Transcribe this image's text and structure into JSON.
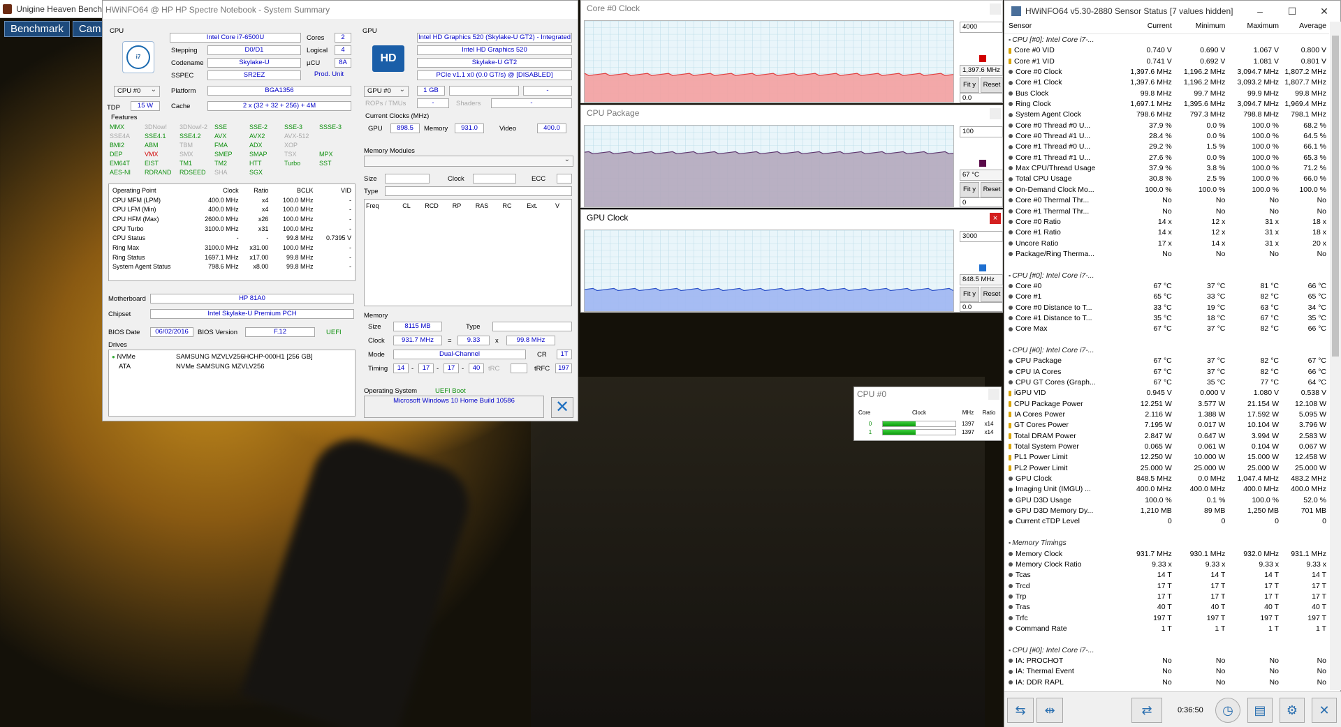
{
  "background": {
    "title": "Unigine Heaven Bench",
    "tabs": [
      "Benchmark",
      "Cam"
    ]
  },
  "summary": {
    "title": "HWiNFO64 @ HP HP Spectre Notebook - System Summary",
    "cpu": {
      "section": "CPU",
      "name": "Intel Core i7-6500U",
      "cores_label": "Cores",
      "cores": "2",
      "stepping_label": "Stepping",
      "stepping": "D0/D1",
      "logical_label": "Logical",
      "logical": "4",
      "codename_label": "Codename",
      "codename": "Skylake-U",
      "ucu_label": "µCU",
      "ucu": "8A",
      "sspec_label": "SSPEC",
      "sspec": "SR2EZ",
      "produnit": "Prod. Unit",
      "selector": "CPU #0",
      "platform_label": "Platform",
      "platform": "BGA1356",
      "tdp_label": "TDP",
      "tdp": "15 W",
      "cache_label": "Cache",
      "cache": "2 x (32 + 32 + 256) + 4M",
      "features_label": "Features"
    },
    "features": [
      [
        "MMX",
        "on"
      ],
      [
        "3DNow!",
        "off"
      ],
      [
        "3DNow!-2",
        "off"
      ],
      [
        "SSE",
        "on"
      ],
      [
        "SSE-2",
        "on"
      ],
      [
        "SSE-3",
        "on"
      ],
      [
        "SSSE-3",
        "on"
      ],
      [
        "SSE4A",
        "off"
      ],
      [
        "SSE4.1",
        "on"
      ],
      [
        "SSE4.2",
        "on"
      ],
      [
        "AVX",
        "on"
      ],
      [
        "AVX2",
        "on"
      ],
      [
        "AVX-512",
        "off"
      ],
      [
        "",
        ""
      ],
      [
        "BMI2",
        "on"
      ],
      [
        "ABM",
        "on"
      ],
      [
        "TBM",
        "off"
      ],
      [
        "FMA",
        "on"
      ],
      [
        "ADX",
        "on"
      ],
      [
        "XOP",
        "off"
      ],
      [
        "",
        ""
      ],
      [
        "DEP",
        "on"
      ],
      [
        "VMX",
        "red"
      ],
      [
        "SMX",
        "off"
      ],
      [
        "SMEP",
        "on"
      ],
      [
        "SMAP",
        "on"
      ],
      [
        "TSX",
        "off"
      ],
      [
        "MPX",
        "on"
      ],
      [
        "EM64T",
        "on"
      ],
      [
        "EIST",
        "on"
      ],
      [
        "TM1",
        "on"
      ],
      [
        "TM2",
        "on"
      ],
      [
        "HTT",
        "on"
      ],
      [
        "Turbo",
        "on"
      ],
      [
        "SST",
        "on"
      ],
      [
        "AES-NI",
        "on"
      ],
      [
        "RDRAND",
        "on"
      ],
      [
        "RDSEED",
        "on"
      ],
      [
        "SHA",
        "off"
      ],
      [
        "SGX",
        "on"
      ],
      [
        "",
        ""
      ],
      [
        "",
        ""
      ]
    ],
    "op_header": [
      "Operating Point",
      "Clock",
      "Ratio",
      "BCLK",
      "VID"
    ],
    "op_rows": [
      [
        "CPU MFM (LPM)",
        "400.0 MHz",
        "x4",
        "100.0 MHz",
        "-"
      ],
      [
        "CPU LFM (Min)",
        "400.0 MHz",
        "x4",
        "100.0 MHz",
        "-"
      ],
      [
        "CPU HFM (Max)",
        "2600.0 MHz",
        "x26",
        "100.0 MHz",
        "-"
      ],
      [
        "CPU Turbo",
        "3100.0 MHz",
        "x31",
        "100.0 MHz",
        "-"
      ],
      [
        "CPU Status",
        "-",
        "-",
        "99.8 MHz",
        "0.7395 V"
      ],
      [
        "Ring Max",
        "3100.0 MHz",
        "x31.00",
        "100.0 MHz",
        "-"
      ],
      [
        "Ring Status",
        "1697.1 MHz",
        "x17.00",
        "99.8 MHz",
        "-"
      ],
      [
        "System Agent Status",
        "798.6 MHz",
        "x8.00",
        "99.8 MHz",
        "-"
      ]
    ],
    "mb": {
      "mb_label": "Motherboard",
      "mb": "HP 81A0",
      "chipset_label": "Chipset",
      "chipset": "Intel Skylake-U Premium PCH",
      "bios_date_label": "BIOS Date",
      "bios_date": "06/02/2016",
      "bios_ver_label": "BIOS Version",
      "bios_ver": "F.12",
      "uefi": "UEFI",
      "drives_label": "Drives",
      "drives": [
        [
          "NVMe",
          "SAMSUNG MZVLV256HCHP-000H1 [256 GB]"
        ],
        [
          "ATA",
          "NVMe SAMSUNG MZVLV256"
        ]
      ]
    },
    "gpu": {
      "section": "GPU",
      "name": "Intel HD Graphics 520 (Skylake-U GT2) - Integrated",
      "model": "Intel HD Graphics 520",
      "codename": "Skylake-U GT2",
      "pcie": "PCIe v1.1 x0 (0.0 GT/s) @ [DISABLED]",
      "selector": "GPU #0",
      "vram": "1 GB",
      "dash1": "-",
      "rops_label": "ROPs / TMUs",
      "rops": "-",
      "shaders_label": "Shaders",
      "shaders": "-",
      "clocks_label": "Current Clocks (MHz)",
      "gpu_label": "GPU",
      "gpu_clk": "898.5",
      "mem_label": "Memory",
      "mem_clk": "931.0",
      "video_label": "Video",
      "video_clk": "400.0"
    },
    "modules": {
      "label": "Memory Modules",
      "size_label": "Size",
      "clock_label": "Clock",
      "ecc_label": "ECC",
      "type_label": "Type",
      "cols": [
        "Freq",
        "CL",
        "RCD",
        "RP",
        "RAS",
        "RC",
        "Ext.",
        "V"
      ]
    },
    "memory": {
      "label": "Memory",
      "size_label": "Size",
      "size": "8115 MB",
      "type_label": "Type",
      "clock_label": "Clock",
      "clock": "931.7 MHz",
      "eq": "=",
      "mult": "9.33",
      "x": "x",
      "bclk": "99.8 MHz",
      "mode_label": "Mode",
      "mode": "Dual-Channel",
      "cr_label": "CR",
      "cr": "1T",
      "timing_label": "Timing",
      "t1": "14",
      "t2": "17",
      "t3": "17",
      "t4": "40",
      "trc": "tRC",
      "trfc_label": "tRFC",
      "trfc": "197",
      "dash": "-"
    },
    "os": {
      "label": "Operating System",
      "boot": "UEFI Boot",
      "name": "Microsoft Windows 10 Home Build 10586"
    }
  },
  "graphs": [
    {
      "title": "Core #0 Clock",
      "max": "4000",
      "cur": "1,397.6 MHz",
      "min": "0.0",
      "color": "#f4a0a0",
      "line": "#e04040",
      "sw": "#d00000",
      "level": 0.35
    },
    {
      "title": "CPU Package",
      "max": "100",
      "cur": "67 °C",
      "min": "0",
      "color": "#b4a8bc",
      "line": "#603870",
      "sw": "#5a0a4a",
      "level": 0.67
    },
    {
      "title": "GPU Clock",
      "max": "3000",
      "cur": "848.5 MHz",
      "min": "0.0",
      "color": "#9fb6f2",
      "line": "#2a50c8",
      "sw": "#1e6fd0",
      "level": 0.28
    }
  ],
  "graph_buttons": {
    "fit": "Fit y",
    "reset": "Reset"
  },
  "cpu0": {
    "title": "CPU #0",
    "cols": [
      "Core",
      "Clock",
      "MHz",
      "Ratio"
    ],
    "rows": [
      [
        "0",
        "1397",
        "x14",
        0.45
      ],
      [
        "1",
        "1397",
        "x14",
        0.45
      ]
    ]
  },
  "sensors": {
    "title": "HWiNFO64 v5.30-2880 Sensor Status [7 values hidden]",
    "cols": [
      "Sensor",
      "Current",
      "Minimum",
      "Maximum",
      "Average"
    ],
    "rows": [
      [
        "g",
        "CPU [#0]: Intel Core i7-...",
        "",
        "",
        "",
        ""
      ],
      [
        "y",
        "Core #0 VID",
        "0.740 V",
        "0.690 V",
        "1.067 V",
        "0.800 V"
      ],
      [
        "y",
        "Core #1 VID",
        "0.741 V",
        "0.692 V",
        "1.081 V",
        "0.801 V"
      ],
      [
        "b",
        "Core #0 Clock",
        "1,397.6 MHz",
        "1,196.2 MHz",
        "3,094.7 MHz",
        "1,807.2 MHz"
      ],
      [
        "b",
        "Core #1 Clock",
        "1,397.6 MHz",
        "1,196.2 MHz",
        "3,093.2 MHz",
        "1,807.7 MHz"
      ],
      [
        "b",
        "Bus Clock",
        "99.8 MHz",
        "99.7 MHz",
        "99.9 MHz",
        "99.8 MHz"
      ],
      [
        "b",
        "Ring Clock",
        "1,697.1 MHz",
        "1,395.6 MHz",
        "3,094.7 MHz",
        "1,969.4 MHz"
      ],
      [
        "b",
        "System Agent Clock",
        "798.6 MHz",
        "797.3 MHz",
        "798.8 MHz",
        "798.1 MHz"
      ],
      [
        "b",
        "Core #0 Thread #0 U...",
        "37.9 %",
        "0.0 %",
        "100.0 %",
        "68.2 %"
      ],
      [
        "b",
        "Core #0 Thread #1 U...",
        "28.4 %",
        "0.0 %",
        "100.0 %",
        "64.5 %"
      ],
      [
        "b",
        "Core #1 Thread #0 U...",
        "29.2 %",
        "1.5 %",
        "100.0 %",
        "66.1 %"
      ],
      [
        "b",
        "Core #1 Thread #1 U...",
        "27.6 %",
        "0.0 %",
        "100.0 %",
        "65.3 %"
      ],
      [
        "b",
        "Max CPU/Thread Usage",
        "37.9 %",
        "3.8 %",
        "100.0 %",
        "71.2 %"
      ],
      [
        "b",
        "Total CPU Usage",
        "30.8 %",
        "2.5 %",
        "100.0 %",
        "66.0 %"
      ],
      [
        "b",
        "On-Demand Clock Mo...",
        "100.0 %",
        "100.0 %",
        "100.0 %",
        "100.0 %"
      ],
      [
        "b",
        "Core #0 Thermal Thr...",
        "No",
        "No",
        "No",
        "No"
      ],
      [
        "b",
        "Core #1 Thermal Thr...",
        "No",
        "No",
        "No",
        "No"
      ],
      [
        "b",
        "Core #0 Ratio",
        "14 x",
        "12 x",
        "31 x",
        "18 x"
      ],
      [
        "b",
        "Core #1 Ratio",
        "14 x",
        "12 x",
        "31 x",
        "18 x"
      ],
      [
        "b",
        "Uncore Ratio",
        "17 x",
        "14 x",
        "31 x",
        "20 x"
      ],
      [
        "b",
        "Package/Ring Therma...",
        "No",
        "No",
        "No",
        "No"
      ],
      [
        "s",
        "",
        "",
        "",
        "",
        ""
      ],
      [
        "g",
        "CPU [#0]: Intel Core i7-...",
        "",
        "",
        "",
        ""
      ],
      [
        "b",
        "Core #0",
        "67 °C",
        "37 °C",
        "81 °C",
        "66 °C"
      ],
      [
        "b",
        "Core #1",
        "65 °C",
        "33 °C",
        "82 °C",
        "65 °C"
      ],
      [
        "b",
        "Core #0 Distance to T...",
        "33 °C",
        "19 °C",
        "63 °C",
        "34 °C"
      ],
      [
        "b",
        "Core #1 Distance to T...",
        "35 °C",
        "18 °C",
        "67 °C",
        "35 °C"
      ],
      [
        "b",
        "Core Max",
        "67 °C",
        "37 °C",
        "82 °C",
        "66 °C"
      ],
      [
        "s",
        "",
        "",
        "",
        "",
        ""
      ],
      [
        "g",
        "CPU [#0]: Intel Core i7-...",
        "",
        "",
        "",
        ""
      ],
      [
        "b",
        "CPU Package",
        "67 °C",
        "37 °C",
        "82 °C",
        "67 °C"
      ],
      [
        "b",
        "CPU IA Cores",
        "67 °C",
        "37 °C",
        "82 °C",
        "66 °C"
      ],
      [
        "b",
        "CPU GT Cores (Graph...",
        "67 °C",
        "35 °C",
        "77 °C",
        "64 °C"
      ],
      [
        "y",
        "iGPU VID",
        "0.945 V",
        "0.000 V",
        "1.080 V",
        "0.538 V"
      ],
      [
        "y",
        "CPU Package Power",
        "12.251 W",
        "3.577 W",
        "21.154 W",
        "12.108 W"
      ],
      [
        "y",
        "IA Cores Power",
        "2.116 W",
        "1.388 W",
        "17.592 W",
        "5.095 W"
      ],
      [
        "y",
        "GT Cores Power",
        "7.195 W",
        "0.017 W",
        "10.104 W",
        "3.796 W"
      ],
      [
        "y",
        "Total DRAM Power",
        "2.847 W",
        "0.647 W",
        "3.994 W",
        "2.583 W"
      ],
      [
        "y",
        "Total System Power",
        "0.065 W",
        "0.061 W",
        "0.104 W",
        "0.067 W"
      ],
      [
        "y",
        "PL1 Power Limit",
        "12.250 W",
        "10.000 W",
        "15.000 W",
        "12.458 W"
      ],
      [
        "y",
        "PL2 Power Limit",
        "25.000 W",
        "25.000 W",
        "25.000 W",
        "25.000 W"
      ],
      [
        "b",
        "GPU Clock",
        "848.5 MHz",
        "0.0 MHz",
        "1,047.4 MHz",
        "483.2 MHz"
      ],
      [
        "b",
        "Imaging Unit (IMGU) ...",
        "400.0 MHz",
        "400.0 MHz",
        "400.0 MHz",
        "400.0 MHz"
      ],
      [
        "b",
        "GPU D3D Usage",
        "100.0 %",
        "0.1 %",
        "100.0 %",
        "52.0 %"
      ],
      [
        "b",
        "GPU D3D Memory Dy...",
        "1,210 MB",
        "89 MB",
        "1,250 MB",
        "701 MB"
      ],
      [
        "b",
        "Current cTDP Level",
        "0",
        "0",
        "0",
        "0"
      ],
      [
        "s",
        "",
        "",
        "",
        "",
        ""
      ],
      [
        "g",
        "Memory Timings",
        "",
        "",
        "",
        ""
      ],
      [
        "b",
        "Memory Clock",
        "931.7 MHz",
        "930.1 MHz",
        "932.0 MHz",
        "931.1 MHz"
      ],
      [
        "b",
        "Memory Clock Ratio",
        "9.33 x",
        "9.33 x",
        "9.33 x",
        "9.33 x"
      ],
      [
        "b",
        "Tcas",
        "14 T",
        "14 T",
        "14 T",
        "14 T"
      ],
      [
        "b",
        "Trcd",
        "17 T",
        "17 T",
        "17 T",
        "17 T"
      ],
      [
        "b",
        "Trp",
        "17 T",
        "17 T",
        "17 T",
        "17 T"
      ],
      [
        "b",
        "Tras",
        "40 T",
        "40 T",
        "40 T",
        "40 T"
      ],
      [
        "b",
        "Trfc",
        "197 T",
        "197 T",
        "197 T",
        "197 T"
      ],
      [
        "b",
        "Command Rate",
        "1 T",
        "1 T",
        "1 T",
        "1 T"
      ],
      [
        "s",
        "",
        "",
        "",
        "",
        ""
      ],
      [
        "g",
        "CPU [#0]: Intel Core i7-...",
        "",
        "",
        "",
        ""
      ],
      [
        "b",
        "IA: PROCHOT",
        "No",
        "No",
        "No",
        "No"
      ],
      [
        "b",
        "IA: Thermal Event",
        "No",
        "No",
        "No",
        "No"
      ],
      [
        "b",
        "IA: DDR RAPL",
        "No",
        "No",
        "No",
        "No"
      ]
    ],
    "timer": "0:36:50",
    "window_controls": [
      "–",
      "☐",
      "✕"
    ]
  }
}
